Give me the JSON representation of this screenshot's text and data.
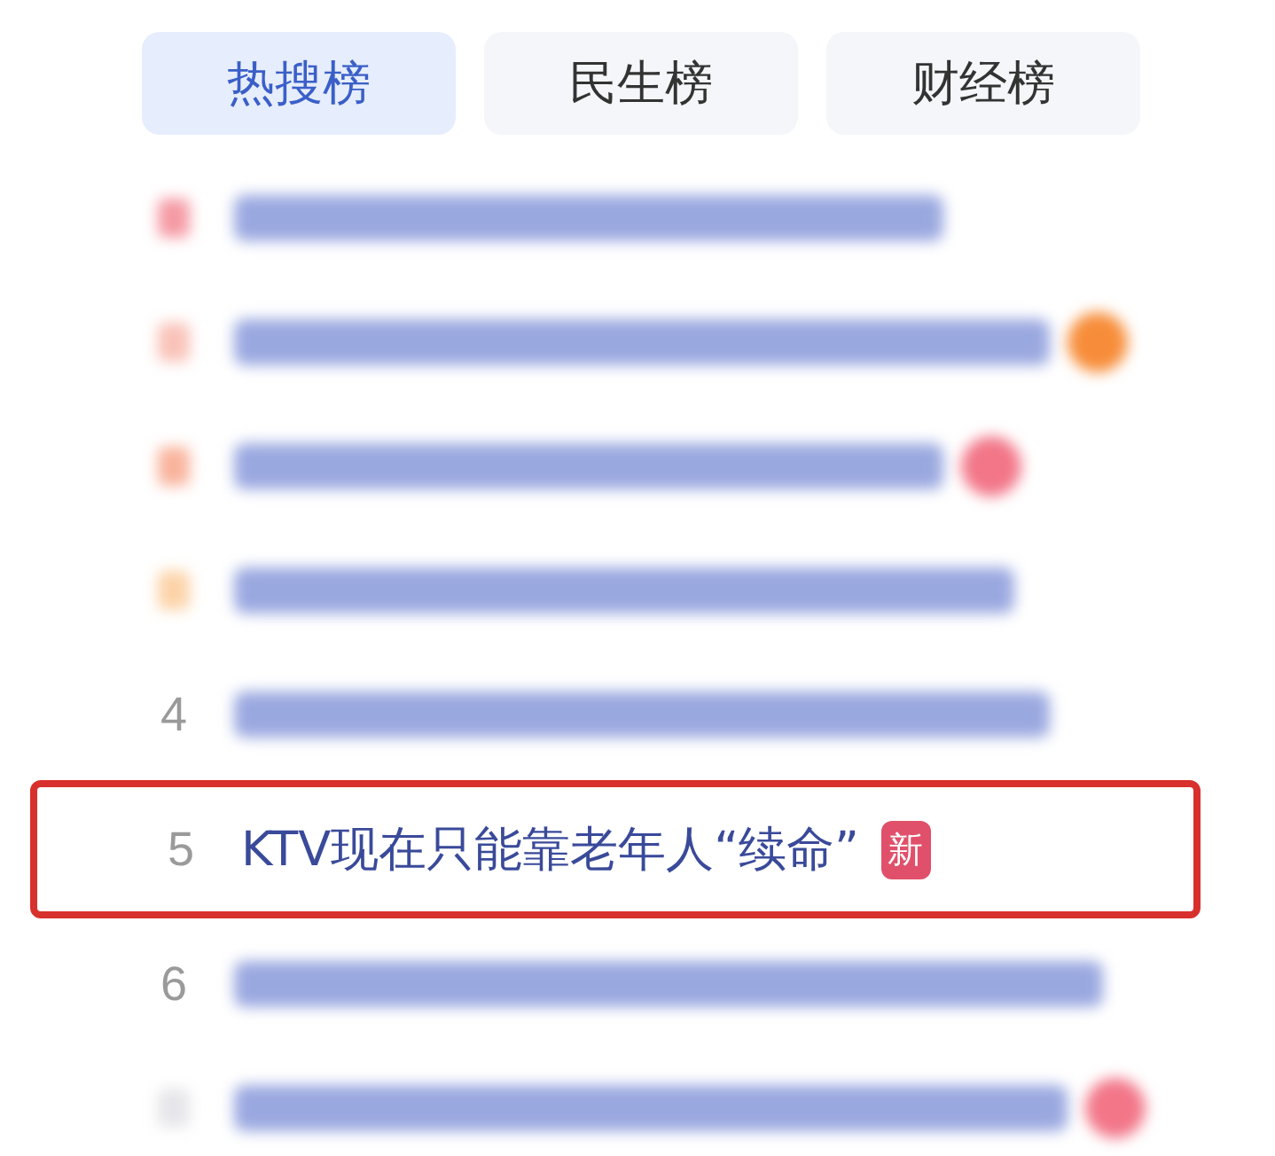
{
  "tabs": [
    {
      "label": "热搜榜",
      "selected": true
    },
    {
      "label": "民生榜",
      "selected": false
    },
    {
      "label": "财经榜",
      "selected": false
    }
  ],
  "rows": [
    {
      "kind": "blurred",
      "color": "#f59aa4"
    },
    {
      "kind": "blurred",
      "color": "#f9c2b8",
      "badge": {
        "color": "#f78d3a"
      }
    },
    {
      "kind": "blurred",
      "color": "#f9b39c",
      "badge": {
        "color": "#f27688"
      }
    },
    {
      "kind": "blurred",
      "color": "#fcd3a8"
    },
    {
      "kind": "blurred",
      "rank": "4"
    },
    {
      "kind": "clear",
      "highlighted": true,
      "rank": "5",
      "title": "KTV现在只能靠老年人“续命”",
      "tag": "新"
    },
    {
      "kind": "blurred",
      "rank": "6"
    },
    {
      "kind": "blurred",
      "badge": {
        "color": "#f27688"
      }
    }
  ]
}
